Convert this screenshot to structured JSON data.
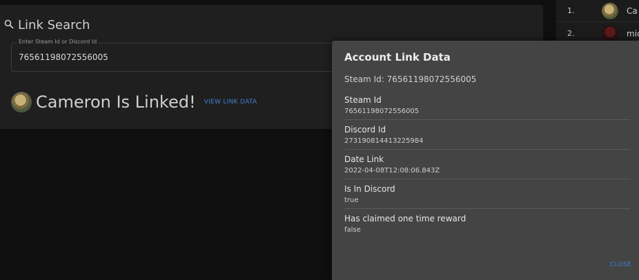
{
  "search": {
    "title": "Link Search",
    "input_label": "Enter Steam Id or Discord Id",
    "input_value": "76561198072556005"
  },
  "result": {
    "linked_text": "Cameron Is Linked!",
    "view_link_label": "VIEW LINK DATA"
  },
  "leaderboard": {
    "rows": [
      {
        "rank": "1.",
        "name": "Ca"
      },
      {
        "rank": "2.",
        "name": "mic"
      }
    ]
  },
  "dialog": {
    "title": "Account Link Data",
    "subtitle": "Steam Id: 76561198072556005",
    "fields": [
      {
        "label": "Steam Id",
        "value": "76561198072556005"
      },
      {
        "label": "Discord Id",
        "value": "273190814413225984"
      },
      {
        "label": "Date Link",
        "value": "2022-04-08T12:08:06.843Z"
      },
      {
        "label": "Is In Discord",
        "value": "true"
      },
      {
        "label": "Has claimed one time reward",
        "value": "false"
      }
    ],
    "close_label": "CLOSE"
  },
  "colors": {
    "accent": "#3f7fd6",
    "background": "#0f0f0f",
    "card": "#1f1f1f",
    "dialog": "#444444"
  }
}
